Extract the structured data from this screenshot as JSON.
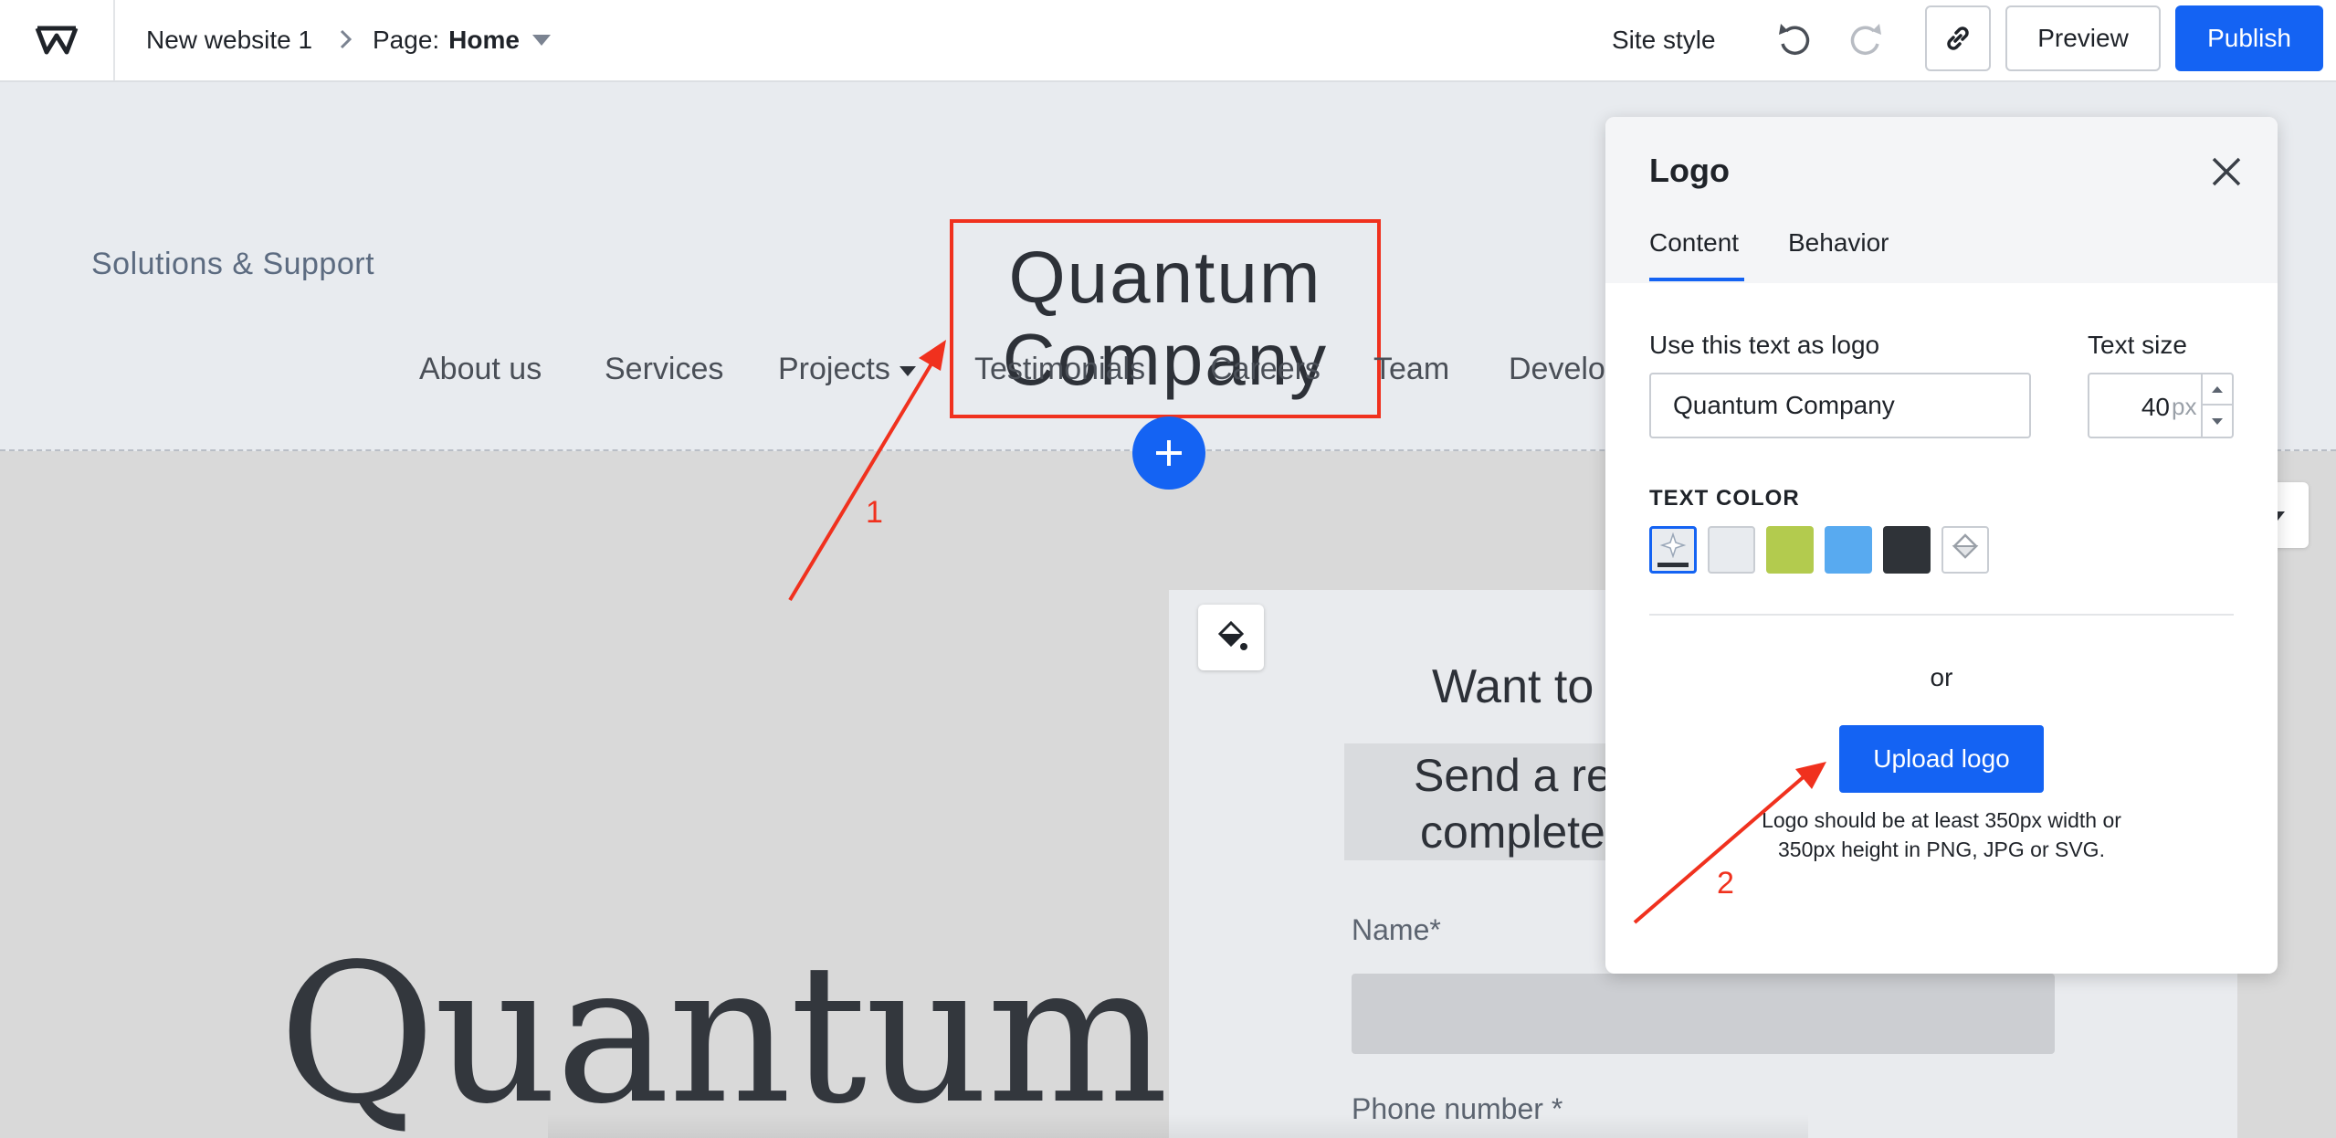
{
  "topbar": {
    "site_name": "New website 1",
    "page_prefix": "Page:",
    "page_name": "Home",
    "site_style": "Site style",
    "preview": "Preview",
    "publish": "Publish"
  },
  "header": {
    "tagline": "Solutions & Support",
    "logo_line1": "Quantum",
    "logo_line2": "Company",
    "nav": [
      "About us",
      "Services",
      "Projects",
      "Testimonials",
      "Careers",
      "Team",
      "Develo"
    ]
  },
  "content": {
    "big_title": "Quantum",
    "form_title": "Want to",
    "send_line1": "Send a re",
    "send_line2": "complete",
    "name_label": "Name*",
    "phone_label": "Phone number *"
  },
  "panel": {
    "title": "Logo",
    "tabs": [
      "Content",
      "Behavior"
    ],
    "text_label": "Use this text as logo",
    "text_value": "Quantum Company",
    "size_label": "Text size",
    "size_value": "40",
    "size_unit": "px",
    "color_heading": "TEXT COLOR",
    "swatches": [
      "#e8ebef",
      "#b3cb4e",
      "#58aaf0",
      "#2f3338"
    ],
    "or": "or",
    "upload": "Upload logo",
    "hint": "Logo should be at least 350px width or 350px height in PNG, JPG or SVG."
  },
  "annotations": {
    "label1": "1",
    "label2": "2",
    "color": "#f0311e"
  }
}
